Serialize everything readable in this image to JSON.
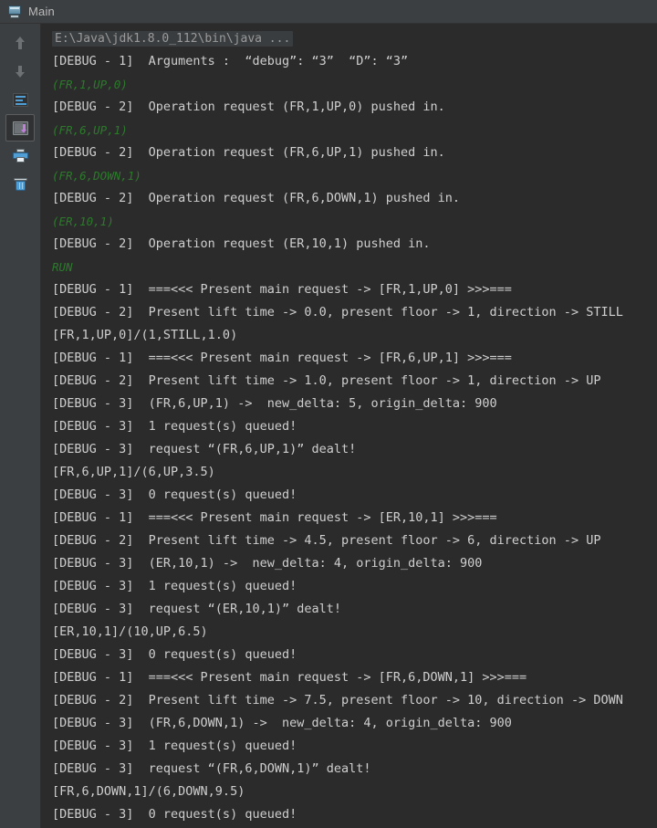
{
  "window": {
    "title": "Main",
    "run_config_icon": "run-configuration-icon"
  },
  "toolbar": {
    "buttons": [
      {
        "name": "up-arrow-icon",
        "tooltip": "Up the Stack Trace"
      },
      {
        "name": "down-arrow-icon",
        "tooltip": "Down the Stack Trace"
      },
      {
        "name": "soft-wrap-icon",
        "tooltip": "Soft-Wrap"
      },
      {
        "name": "scroll-to-end-icon",
        "tooltip": "Scroll to the end",
        "selected": true
      },
      {
        "name": "print-icon",
        "tooltip": "Print"
      },
      {
        "name": "trash-icon",
        "tooltip": "Clear All"
      }
    ]
  },
  "console": {
    "lines": [
      {
        "type": "cmd",
        "text": "E:\\Java\\jdk1.8.0_112\\bin\\java ..."
      },
      {
        "type": "out",
        "text": "[DEBUG - 1]  Arguments :  “debug”: “3”  “D”: “3”"
      },
      {
        "type": "input",
        "text": "(FR,1,UP,0)"
      },
      {
        "type": "out",
        "text": "[DEBUG - 2]  Operation request (FR,1,UP,0) pushed in."
      },
      {
        "type": "input",
        "text": "(FR,6,UP,1)"
      },
      {
        "type": "out",
        "text": "[DEBUG - 2]  Operation request (FR,6,UP,1) pushed in."
      },
      {
        "type": "input",
        "text": "(FR,6,DOWN,1)"
      },
      {
        "type": "out",
        "text": "[DEBUG - 2]  Operation request (FR,6,DOWN,1) pushed in."
      },
      {
        "type": "input",
        "text": "(ER,10,1)"
      },
      {
        "type": "out",
        "text": "[DEBUG - 2]  Operation request (ER,10,1) pushed in."
      },
      {
        "type": "input",
        "text": "RUN"
      },
      {
        "type": "out",
        "text": "[DEBUG - 1]  ===<<< Present main request -> [FR,1,UP,0] >>>==="
      },
      {
        "type": "out",
        "text": "[DEBUG - 2]  Present lift time -> 0.0, present floor -> 1, direction -> STILL"
      },
      {
        "type": "out",
        "text": "[FR,1,UP,0]/(1,STILL,1.0)"
      },
      {
        "type": "out",
        "text": "[DEBUG - 1]  ===<<< Present main request -> [FR,6,UP,1] >>>==="
      },
      {
        "type": "out",
        "text": "[DEBUG - 2]  Present lift time -> 1.0, present floor -> 1, direction -> UP"
      },
      {
        "type": "out",
        "text": "[DEBUG - 3]  (FR,6,UP,1) ->  new_delta: 5, origin_delta: 900"
      },
      {
        "type": "out",
        "text": "[DEBUG - 3]  1 request(s) queued!"
      },
      {
        "type": "out",
        "text": "[DEBUG - 3]  request “(FR,6,UP,1)” dealt!"
      },
      {
        "type": "out",
        "text": "[FR,6,UP,1]/(6,UP,3.5)"
      },
      {
        "type": "out",
        "text": "[DEBUG - 3]  0 request(s) queued!"
      },
      {
        "type": "out",
        "text": "[DEBUG - 1]  ===<<< Present main request -> [ER,10,1] >>>==="
      },
      {
        "type": "out",
        "text": "[DEBUG - 2]  Present lift time -> 4.5, present floor -> 6, direction -> UP"
      },
      {
        "type": "out",
        "text": "[DEBUG - 3]  (ER,10,1) ->  new_delta: 4, origin_delta: 900"
      },
      {
        "type": "out",
        "text": "[DEBUG - 3]  1 request(s) queued!"
      },
      {
        "type": "out",
        "text": "[DEBUG - 3]  request “(ER,10,1)” dealt!"
      },
      {
        "type": "out",
        "text": "[ER,10,1]/(10,UP,6.5)"
      },
      {
        "type": "out",
        "text": "[DEBUG - 3]  0 request(s) queued!"
      },
      {
        "type": "out",
        "text": "[DEBUG - 1]  ===<<< Present main request -> [FR,6,DOWN,1] >>>==="
      },
      {
        "type": "out",
        "text": "[DEBUG - 2]  Present lift time -> 7.5, present floor -> 10, direction -> DOWN"
      },
      {
        "type": "out",
        "text": "[DEBUG - 3]  (FR,6,DOWN,1) ->  new_delta: 4, origin_delta: 900"
      },
      {
        "type": "out",
        "text": "[DEBUG - 3]  1 request(s) queued!"
      },
      {
        "type": "out",
        "text": "[DEBUG - 3]  request “(FR,6,DOWN,1)” dealt!"
      },
      {
        "type": "out",
        "text": "[FR,6,DOWN,1]/(6,DOWN,9.5)"
      },
      {
        "type": "out",
        "text": "[DEBUG - 3]  0 request(s) queued!"
      }
    ]
  },
  "colors": {
    "window_chrome": "#3c3f41",
    "console_background": "#2b2b2b",
    "output_text": "#cfcfcf",
    "input_text": "#2d7a2d",
    "command_text": "#9a9a9a",
    "accent_blue": "#4f9fd6",
    "accent_purple": "#c07fd8"
  }
}
